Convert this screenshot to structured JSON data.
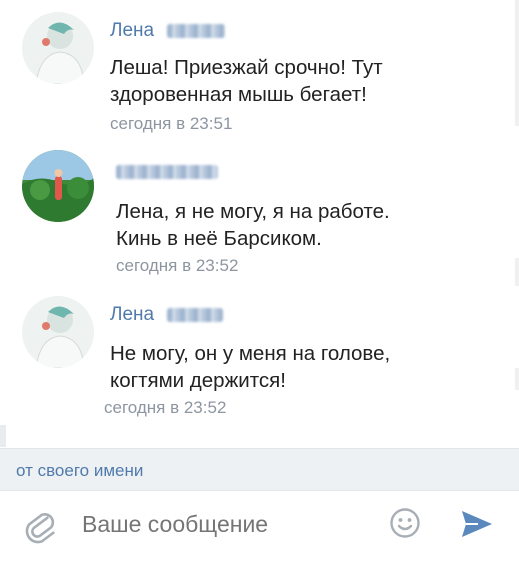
{
  "messages": [
    {
      "author": "Лена",
      "text": "Леша! Приезжай срочно! Тут\nздоровенная мышь бегает!",
      "time": "сегодня в 23:51"
    },
    {
      "author": "",
      "text": "Лена, я не могу, я на работе.\nКинь в неё Барсиком.",
      "time": "сегодня в 23:52"
    },
    {
      "author": "Лена",
      "text": "Не могу, он у меня на голове,\nкогтями держится!",
      "time": "сегодня в 23:52"
    }
  ],
  "sender": {
    "label": "от своего имени"
  },
  "composer": {
    "placeholder": "Ваше сообщение"
  },
  "icons": {
    "attach": "paperclip-icon",
    "emoji": "smiley-icon",
    "send": "send-arrow-icon"
  },
  "colors": {
    "accent": "#4f7aab",
    "time": "#8d96a0",
    "send": "#5b88bd"
  }
}
